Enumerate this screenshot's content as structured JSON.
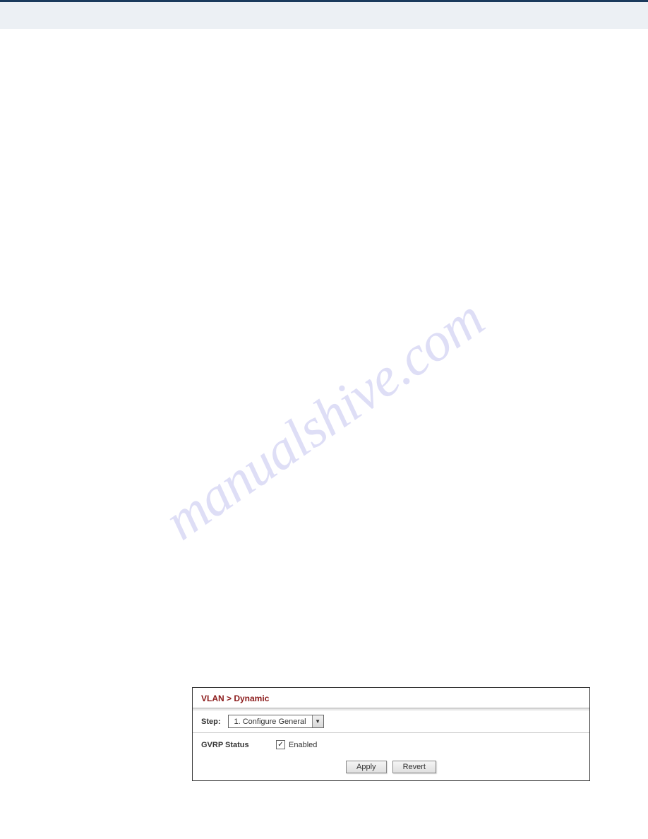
{
  "watermark": "manualshive.com",
  "panel": {
    "title": "VLAN > Dynamic",
    "step": {
      "label": "Step:",
      "selected": "1. Configure General"
    },
    "form": {
      "gvrp_label": "GVRP Status",
      "enabled_label": "Enabled",
      "checked": true
    },
    "buttons": {
      "apply": "Apply",
      "revert": "Revert"
    }
  }
}
